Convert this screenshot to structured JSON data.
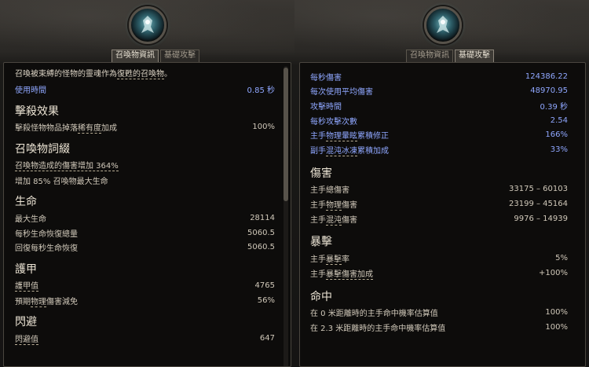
{
  "summon_tab_label": "召喚物資訊",
  "base_attack_tab_label": "基礎攻擊",
  "left": {
    "intro": {
      "prefix": "召喚被束縛的怪物的靈魂作為",
      "link": "復甦的召喚物",
      "suffix": "。"
    },
    "use_time": {
      "label": "使用時間",
      "value": "0.85 秒"
    },
    "kill_effects": {
      "title": "擊殺效果",
      "rows": [
        {
          "label": "擊殺怪物物品掉落稀有度加成",
          "value": "100%"
        }
      ]
    },
    "summon_affixes": {
      "title": "召喚物詞綴",
      "rows": [
        {
          "label": "召喚物造成的傷害增加 364%"
        },
        {
          "label": "增加 85% 召喚物最大生命"
        }
      ]
    },
    "life": {
      "title": "生命",
      "rows": [
        {
          "label": "最大生命",
          "value": "28114"
        },
        {
          "label": "每秒生命恢復總量",
          "value": "5060.5"
        },
        {
          "label": "回復每秒生命恢復",
          "value": "5060.5"
        }
      ]
    },
    "armour": {
      "title": "護甲",
      "rows": [
        {
          "label": "護甲值",
          "value": "4765"
        },
        {
          "label": "預期物理傷害減免",
          "value": "56%"
        }
      ]
    },
    "evasion": {
      "title": "閃避",
      "rows": [
        {
          "label": "閃避值",
          "value": "647"
        }
      ]
    }
  },
  "right": {
    "top_rows": [
      {
        "label": "每秒傷害",
        "value": "124386.22"
      },
      {
        "label": "每次使用平均傷害",
        "value": "48970.95"
      },
      {
        "label": "攻擊時間",
        "value": "0.39 秒"
      },
      {
        "label": "每秒攻擊次數",
        "value": "2.54"
      },
      {
        "label": "主手物理暈眩累積修正",
        "value": "166%"
      },
      {
        "label": "副手混沌冰凍累積加成",
        "value": "33%"
      }
    ],
    "damage": {
      "title": "傷害",
      "rows": [
        {
          "label": "主手總傷害",
          "value": "33175 – 60103"
        },
        {
          "label": "主手物理傷害",
          "value": "23199 – 45164"
        },
        {
          "label": "主手混沌傷害",
          "value": "9976 – 14939"
        }
      ]
    },
    "crit": {
      "title": "暴擊",
      "rows": [
        {
          "label": "主手暴擊率",
          "value": "5%"
        },
        {
          "label": "主手暴擊傷害加成",
          "value": "+100%"
        }
      ]
    },
    "accuracy": {
      "title": "命中",
      "rows": [
        {
          "label": "在 0 米距離時的主手命中機率估算值",
          "value": "100%"
        },
        {
          "label": "在 2.3 米距離時的主手命中機率估算值",
          "value": "100%"
        }
      ]
    }
  }
}
